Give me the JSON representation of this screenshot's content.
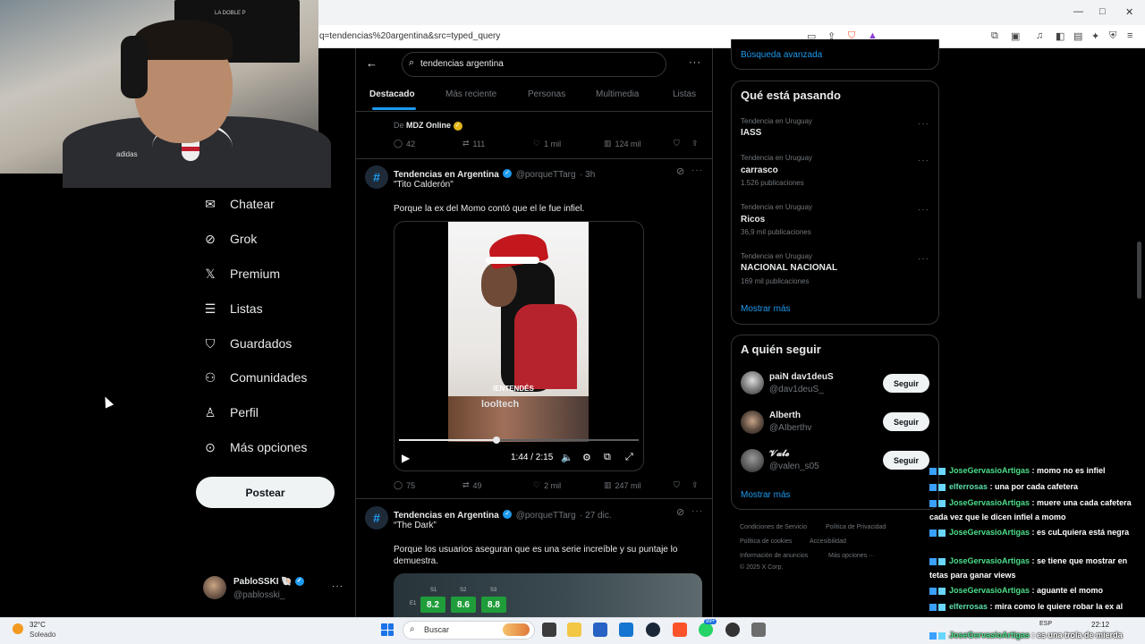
{
  "browser": {
    "url": "q=tendencias%20argentina&src=typed_query",
    "window_controls": [
      "—",
      "□",
      "✕"
    ]
  },
  "webcam": {
    "flag_text": "LA DOBLE P",
    "shirt_logo": "adidas"
  },
  "nav": {
    "items": [
      {
        "label": "Chatear",
        "icon": "envelope-icon"
      },
      {
        "label": "Grok",
        "icon": "grok-icon"
      },
      {
        "label": "Premium",
        "icon": "x-logo-icon"
      },
      {
        "label": "Listas",
        "icon": "list-icon"
      },
      {
        "label": "Guardados",
        "icon": "bookmark-icon"
      },
      {
        "label": "Comunidades",
        "icon": "communities-icon"
      },
      {
        "label": "Perfil",
        "icon": "person-icon"
      },
      {
        "label": "Más opciones",
        "icon": "more-circle-icon"
      }
    ],
    "post_button": "Postear",
    "profile": {
      "name": "PabloSSKI",
      "name_suffix": "🐚",
      "handle": "@pablosski_",
      "more": "···"
    }
  },
  "search": {
    "query": "tendencias argentina",
    "more": "···"
  },
  "tabs": [
    "Destacado",
    "Más reciente",
    "Personas",
    "Multimedia",
    "Listas"
  ],
  "posts": [
    {
      "source_prefix": "De",
      "source": "MDZ Online",
      "stats": {
        "replies": "42",
        "reposts": "111",
        "likes": "1 mil",
        "views": "124 mil"
      }
    },
    {
      "author": "Tendencias en Argentina",
      "handle": "@porqueTTarg",
      "time": "· 3h",
      "title": "\"Tito Calderón\"",
      "text": "Porque la ex del Momo contó que el le fue infiel.",
      "video": {
        "caption": "/ENTENDÉS",
        "inset_text": "looltech",
        "time": "1:44 / 2:15",
        "progress": 0.81
      },
      "stats": {
        "replies": "75",
        "reposts": "49",
        "likes": "2 mil",
        "views": "247 mil"
      }
    },
    {
      "author": "Tendencias en Argentina",
      "handle": "@porqueTTarg",
      "time": "· 27 dic.",
      "title": "“The Dark”",
      "text": "Porque los usuarios aseguran que es una serie increíble y su puntaje lo demuestra.",
      "media": {
        "row_label": "E1",
        "seasons": [
          "S1",
          "S2",
          "S3"
        ],
        "scores": [
          "8.2",
          "8.6",
          "8.8"
        ]
      }
    }
  ],
  "right": {
    "advanced_search": "Búsqueda avanzada",
    "trending_title": "Qué está pasando",
    "trends": [
      {
        "label": "Tendencia en Uruguay",
        "name": "IASS",
        "count": ""
      },
      {
        "label": "Tendencia en Uruguay",
        "name": "carrasco",
        "count": "1.526 publicaciones"
      },
      {
        "label": "Tendencia en Uruguay",
        "name": "Ricos",
        "count": "36,9 mil publicaciones"
      },
      {
        "label": "Tendencia en Uruguay",
        "name": "NACIONAL NACIONAL",
        "count": "169 mil publicaciones"
      }
    ],
    "show_more": "Mostrar más",
    "follow_title": "A quién seguir",
    "follow": [
      {
        "name": "paiN dav1deuS",
        "handle": "@dav1deuS_",
        "button": "Seguir"
      },
      {
        "name": "Alberth",
        "handle": "@AIberthv",
        "button": "Seguir"
      },
      {
        "name": "𝓥𝓪𝓵𝓮",
        "handle": "@valen_s05",
        "button": "Seguir"
      }
    ],
    "footer": [
      "Condiciones de Servicio",
      "Política de Privacidad",
      "Política de cookies",
      "Accesibilidad",
      "Información de anuncios",
      "Más opciones ···",
      "© 2025 X Corp."
    ]
  },
  "chat": [
    {
      "user": "JoseGervasioArtigas",
      "msg": " : momo no es infiel"
    },
    {
      "user": "elferrosas",
      "msg": " : una por cada cafetera"
    },
    {
      "user": "JoseGervasioArtigas",
      "msg": " : muere una cada cafetera cada vez que le dicen infiel a momo"
    },
    {
      "user": "JoseGervasioArtigas",
      "msg": " : es cuLquiera está negra"
    },
    {
      "user": "JoseGervasioArtigas",
      "msg": " : se tiene que mostrar en tetas para ganar views"
    },
    {
      "user": "JoseGervasioArtigas",
      "msg": " : aguante el momo"
    },
    {
      "user": "elferrosas",
      "msg": " : mira como le quiere robar la ex al momo"
    },
    {
      "user": "JoseGervasioArtigas",
      "msg": " : es una trola de mierda"
    }
  ],
  "taskbar": {
    "temp": "32°C",
    "weather": "Soleado",
    "search": "Buscar",
    "badge": "99+",
    "lang": "ESP",
    "time": "22:12"
  }
}
